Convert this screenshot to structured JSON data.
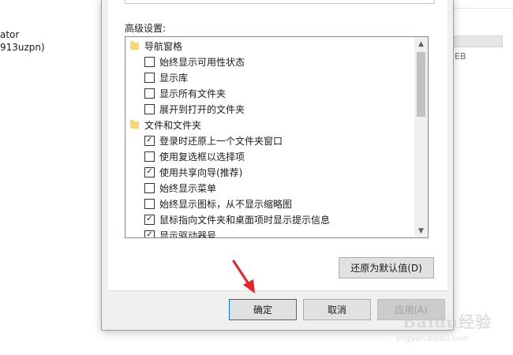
{
  "background": {
    "user_line1": "ator",
    "user_line2": "913uzpn)",
    "storage_unit": "EB"
  },
  "dialog": {
    "advanced_label": "高级设置:",
    "tree_items": [
      {
        "type": "folder",
        "label": "导航窗格"
      },
      {
        "type": "checkbox",
        "label": "始终显示可用性状态",
        "checked": false
      },
      {
        "type": "checkbox",
        "label": "显示库",
        "checked": false
      },
      {
        "type": "checkbox",
        "label": "显示所有文件夹",
        "checked": false
      },
      {
        "type": "checkbox",
        "label": "展开到打开的文件夹",
        "checked": false
      },
      {
        "type": "folder",
        "label": "文件和文件夹"
      },
      {
        "type": "checkbox",
        "label": "登录时还原上一个文件夹窗口",
        "checked": true
      },
      {
        "type": "checkbox",
        "label": "使用复选框以选择项",
        "checked": false
      },
      {
        "type": "checkbox",
        "label": "使用共享向导(推荐)",
        "checked": true
      },
      {
        "type": "checkbox",
        "label": "始终显示菜单",
        "checked": false
      },
      {
        "type": "checkbox",
        "label": "始终显示图标，从不显示缩略图",
        "checked": false
      },
      {
        "type": "checkbox",
        "label": "鼠标指向文件夹和桌面项时显示提示信息",
        "checked": true
      },
      {
        "type": "checkbox",
        "label": "显示驱动器号",
        "checked": true
      }
    ],
    "restore_defaults_label": "还原为默认值(D)",
    "ok_label": "确定",
    "cancel_label": "取消",
    "apply_label": "应用(A)"
  },
  "watermark": {
    "brand": "Baidu经验",
    "url": "jingyan.baidu.com"
  },
  "colors": {
    "dialog_bg": "#f0f0f0",
    "accent": "#0078d7",
    "arrow": "#e8242a",
    "folder": "#f7d774"
  }
}
